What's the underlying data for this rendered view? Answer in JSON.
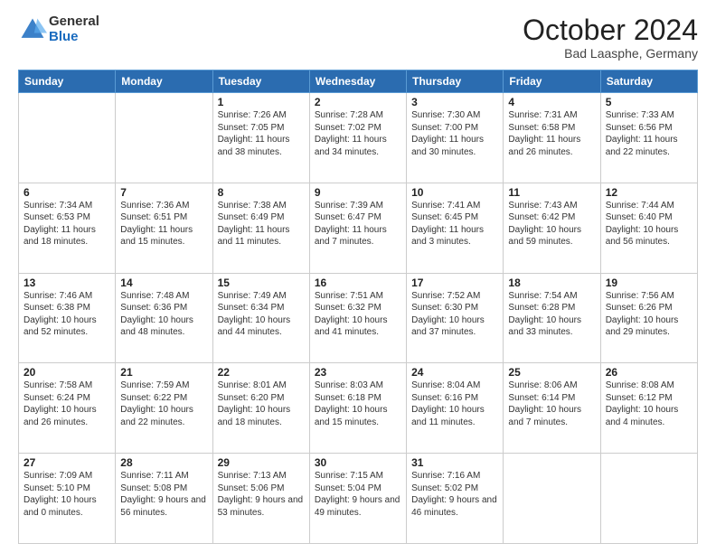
{
  "header": {
    "logo_general": "General",
    "logo_blue": "Blue",
    "month_title": "October 2024",
    "location": "Bad Laasphe, Germany"
  },
  "weekdays": [
    "Sunday",
    "Monday",
    "Tuesday",
    "Wednesday",
    "Thursday",
    "Friday",
    "Saturday"
  ],
  "weeks": [
    [
      {
        "day": "",
        "empty": true
      },
      {
        "day": "",
        "empty": true
      },
      {
        "day": "1",
        "sunrise": "Sunrise: 7:26 AM",
        "sunset": "Sunset: 7:05 PM",
        "daylight": "Daylight: 11 hours and 38 minutes."
      },
      {
        "day": "2",
        "sunrise": "Sunrise: 7:28 AM",
        "sunset": "Sunset: 7:02 PM",
        "daylight": "Daylight: 11 hours and 34 minutes."
      },
      {
        "day": "3",
        "sunrise": "Sunrise: 7:30 AM",
        "sunset": "Sunset: 7:00 PM",
        "daylight": "Daylight: 11 hours and 30 minutes."
      },
      {
        "day": "4",
        "sunrise": "Sunrise: 7:31 AM",
        "sunset": "Sunset: 6:58 PM",
        "daylight": "Daylight: 11 hours and 26 minutes."
      },
      {
        "day": "5",
        "sunrise": "Sunrise: 7:33 AM",
        "sunset": "Sunset: 6:56 PM",
        "daylight": "Daylight: 11 hours and 22 minutes."
      }
    ],
    [
      {
        "day": "6",
        "sunrise": "Sunrise: 7:34 AM",
        "sunset": "Sunset: 6:53 PM",
        "daylight": "Daylight: 11 hours and 18 minutes."
      },
      {
        "day": "7",
        "sunrise": "Sunrise: 7:36 AM",
        "sunset": "Sunset: 6:51 PM",
        "daylight": "Daylight: 11 hours and 15 minutes."
      },
      {
        "day": "8",
        "sunrise": "Sunrise: 7:38 AM",
        "sunset": "Sunset: 6:49 PM",
        "daylight": "Daylight: 11 hours and 11 minutes."
      },
      {
        "day": "9",
        "sunrise": "Sunrise: 7:39 AM",
        "sunset": "Sunset: 6:47 PM",
        "daylight": "Daylight: 11 hours and 7 minutes."
      },
      {
        "day": "10",
        "sunrise": "Sunrise: 7:41 AM",
        "sunset": "Sunset: 6:45 PM",
        "daylight": "Daylight: 11 hours and 3 minutes."
      },
      {
        "day": "11",
        "sunrise": "Sunrise: 7:43 AM",
        "sunset": "Sunset: 6:42 PM",
        "daylight": "Daylight: 10 hours and 59 minutes."
      },
      {
        "day": "12",
        "sunrise": "Sunrise: 7:44 AM",
        "sunset": "Sunset: 6:40 PM",
        "daylight": "Daylight: 10 hours and 56 minutes."
      }
    ],
    [
      {
        "day": "13",
        "sunrise": "Sunrise: 7:46 AM",
        "sunset": "Sunset: 6:38 PM",
        "daylight": "Daylight: 10 hours and 52 minutes."
      },
      {
        "day": "14",
        "sunrise": "Sunrise: 7:48 AM",
        "sunset": "Sunset: 6:36 PM",
        "daylight": "Daylight: 10 hours and 48 minutes."
      },
      {
        "day": "15",
        "sunrise": "Sunrise: 7:49 AM",
        "sunset": "Sunset: 6:34 PM",
        "daylight": "Daylight: 10 hours and 44 minutes."
      },
      {
        "day": "16",
        "sunrise": "Sunrise: 7:51 AM",
        "sunset": "Sunset: 6:32 PM",
        "daylight": "Daylight: 10 hours and 41 minutes."
      },
      {
        "day": "17",
        "sunrise": "Sunrise: 7:52 AM",
        "sunset": "Sunset: 6:30 PM",
        "daylight": "Daylight: 10 hours and 37 minutes."
      },
      {
        "day": "18",
        "sunrise": "Sunrise: 7:54 AM",
        "sunset": "Sunset: 6:28 PM",
        "daylight": "Daylight: 10 hours and 33 minutes."
      },
      {
        "day": "19",
        "sunrise": "Sunrise: 7:56 AM",
        "sunset": "Sunset: 6:26 PM",
        "daylight": "Daylight: 10 hours and 29 minutes."
      }
    ],
    [
      {
        "day": "20",
        "sunrise": "Sunrise: 7:58 AM",
        "sunset": "Sunset: 6:24 PM",
        "daylight": "Daylight: 10 hours and 26 minutes."
      },
      {
        "day": "21",
        "sunrise": "Sunrise: 7:59 AM",
        "sunset": "Sunset: 6:22 PM",
        "daylight": "Daylight: 10 hours and 22 minutes."
      },
      {
        "day": "22",
        "sunrise": "Sunrise: 8:01 AM",
        "sunset": "Sunset: 6:20 PM",
        "daylight": "Daylight: 10 hours and 18 minutes."
      },
      {
        "day": "23",
        "sunrise": "Sunrise: 8:03 AM",
        "sunset": "Sunset: 6:18 PM",
        "daylight": "Daylight: 10 hours and 15 minutes."
      },
      {
        "day": "24",
        "sunrise": "Sunrise: 8:04 AM",
        "sunset": "Sunset: 6:16 PM",
        "daylight": "Daylight: 10 hours and 11 minutes."
      },
      {
        "day": "25",
        "sunrise": "Sunrise: 8:06 AM",
        "sunset": "Sunset: 6:14 PM",
        "daylight": "Daylight: 10 hours and 7 minutes."
      },
      {
        "day": "26",
        "sunrise": "Sunrise: 8:08 AM",
        "sunset": "Sunset: 6:12 PM",
        "daylight": "Daylight: 10 hours and 4 minutes."
      }
    ],
    [
      {
        "day": "27",
        "sunrise": "Sunrise: 7:09 AM",
        "sunset": "Sunset: 5:10 PM",
        "daylight": "Daylight: 10 hours and 0 minutes."
      },
      {
        "day": "28",
        "sunrise": "Sunrise: 7:11 AM",
        "sunset": "Sunset: 5:08 PM",
        "daylight": "Daylight: 9 hours and 56 minutes."
      },
      {
        "day": "29",
        "sunrise": "Sunrise: 7:13 AM",
        "sunset": "Sunset: 5:06 PM",
        "daylight": "Daylight: 9 hours and 53 minutes."
      },
      {
        "day": "30",
        "sunrise": "Sunrise: 7:15 AM",
        "sunset": "Sunset: 5:04 PM",
        "daylight": "Daylight: 9 hours and 49 minutes."
      },
      {
        "day": "31",
        "sunrise": "Sunrise: 7:16 AM",
        "sunset": "Sunset: 5:02 PM",
        "daylight": "Daylight: 9 hours and 46 minutes."
      },
      {
        "day": "",
        "empty": true
      },
      {
        "day": "",
        "empty": true
      }
    ]
  ]
}
